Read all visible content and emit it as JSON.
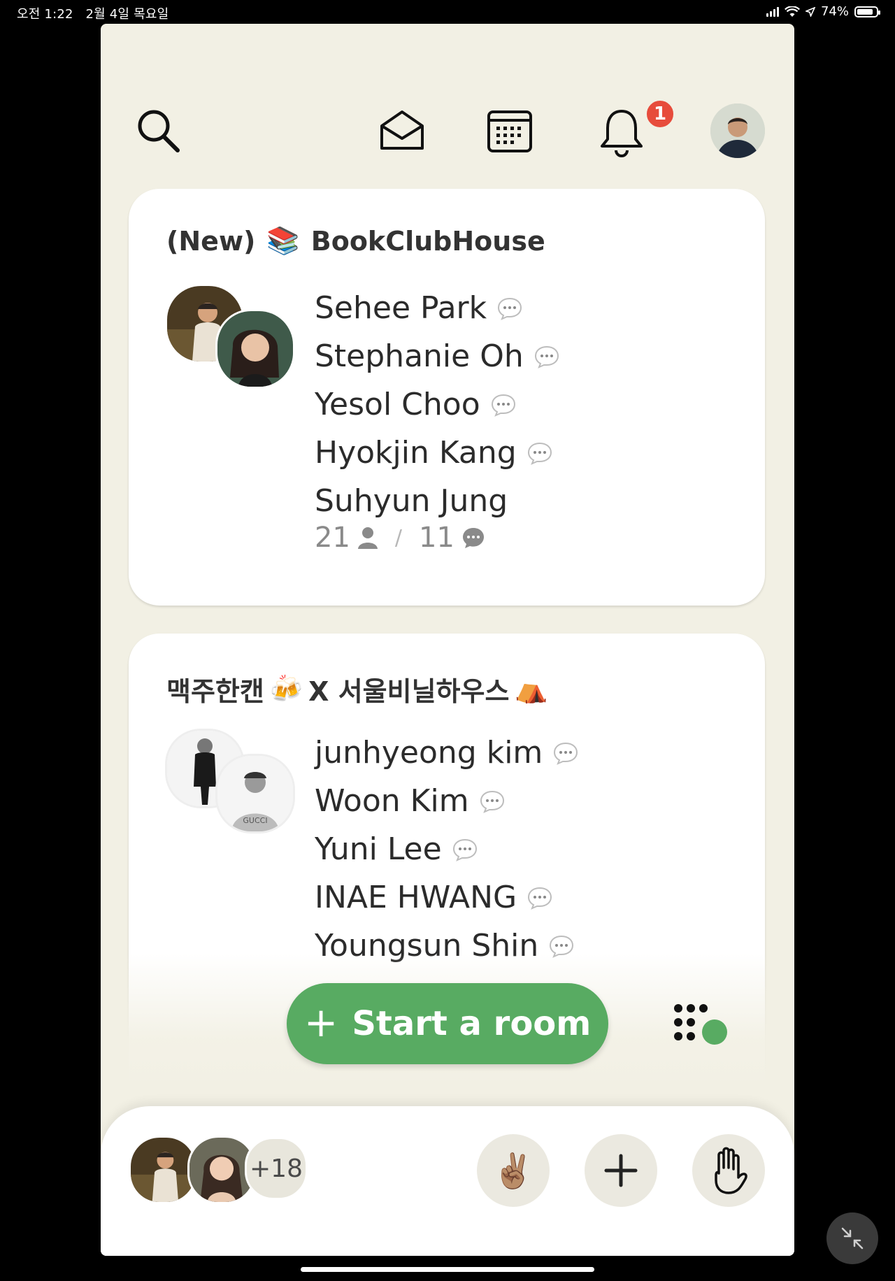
{
  "status_bar": {
    "time": "오전 1:22",
    "date": "2월 4일 목요일",
    "battery": "74%",
    "battery_level": 0.74
  },
  "topbar": {
    "notification_count": "1",
    "icons": [
      "search-icon",
      "inbox-icon",
      "calendar-icon",
      "bell-icon",
      "profile-avatar"
    ]
  },
  "rooms": [
    {
      "prefix": "(New)",
      "emoji": "📚",
      "name": "BookClubHouse",
      "speakers": [
        {
          "name": "Sehee Park",
          "chat": true
        },
        {
          "name": "Stephanie Oh",
          "chat": true
        },
        {
          "name": "Yesol Choo",
          "chat": true
        },
        {
          "name": "Hyokjin Kang",
          "chat": true
        },
        {
          "name": "Suhyun Jung",
          "chat": false
        }
      ],
      "listeners": "21",
      "speakers_count": "11"
    },
    {
      "title_part1": "맥주한캔",
      "emoji1": "🍻",
      "title_part2": "X 서울비닐하우스",
      "emoji2": "⛺",
      "speakers": [
        {
          "name": "junhyeong kim",
          "chat": true
        },
        {
          "name": "Woon Kim",
          "chat": true
        },
        {
          "name": "Yuni Lee",
          "chat": true
        },
        {
          "name": "INAE HWANG",
          "chat": true
        },
        {
          "name": "Youngsun Shin",
          "chat": true
        }
      ]
    }
  ],
  "start_room": {
    "label": "Start a room",
    "plus": "+"
  },
  "bottom_bar": {
    "more_count": "+18",
    "buttons": [
      "peace-emoji-button",
      "add-button",
      "raise-hand-button"
    ],
    "peace_emoji": "✌🏽"
  },
  "colors": {
    "background": "#f2f0e4",
    "accent_green": "#58ab62",
    "badge_red": "#e74c3c"
  }
}
